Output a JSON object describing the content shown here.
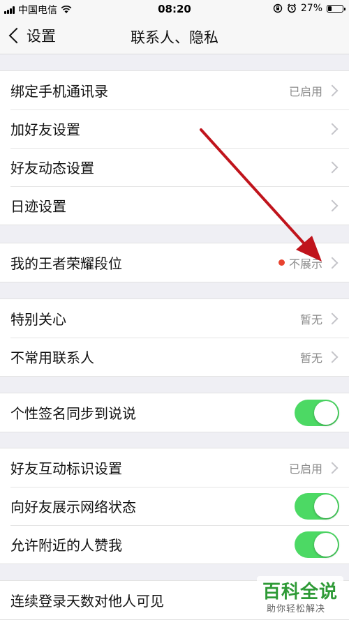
{
  "status_bar": {
    "carrier": "中国电信",
    "time": "08:20",
    "battery": "27%",
    "battery_level": 0.27
  },
  "nav": {
    "back_label": "设置",
    "title": "联系人、隐私"
  },
  "sections": [
    {
      "rows": [
        {
          "label": "绑定手机通讯录",
          "value": "已启用",
          "control": "chevron"
        },
        {
          "label": "加好友设置",
          "value": "",
          "control": "chevron"
        },
        {
          "label": "好友动态设置",
          "value": "",
          "control": "chevron"
        },
        {
          "label": "日迹设置",
          "value": "",
          "control": "chevron"
        }
      ]
    },
    {
      "rows": [
        {
          "label": "我的王者荣耀段位",
          "value": "不展示",
          "control": "chevron",
          "dot": true
        }
      ]
    },
    {
      "rows": [
        {
          "label": "特别关心",
          "value": "暂无",
          "control": "chevron"
        },
        {
          "label": "不常用联系人",
          "value": "暂无",
          "control": "chevron"
        }
      ]
    },
    {
      "rows": [
        {
          "label": "个性签名同步到说说",
          "value": "",
          "control": "toggle",
          "on": true
        }
      ]
    },
    {
      "rows": [
        {
          "label": "好友互动标识设置",
          "value": "已启用",
          "control": "chevron"
        },
        {
          "label": "向好友展示网络状态",
          "value": "",
          "control": "toggle",
          "on": true
        },
        {
          "label": "允许附近的人赞我",
          "value": "",
          "control": "toggle",
          "on": true
        }
      ]
    },
    {
      "rows": [
        {
          "label": "连续登录天数对他人可见",
          "value": "",
          "control": "none"
        }
      ]
    }
  ],
  "annotation": {
    "arrow_color": "#c0141c"
  },
  "watermark": {
    "title": "百科全说",
    "subtitle": "助你轻松解决"
  }
}
